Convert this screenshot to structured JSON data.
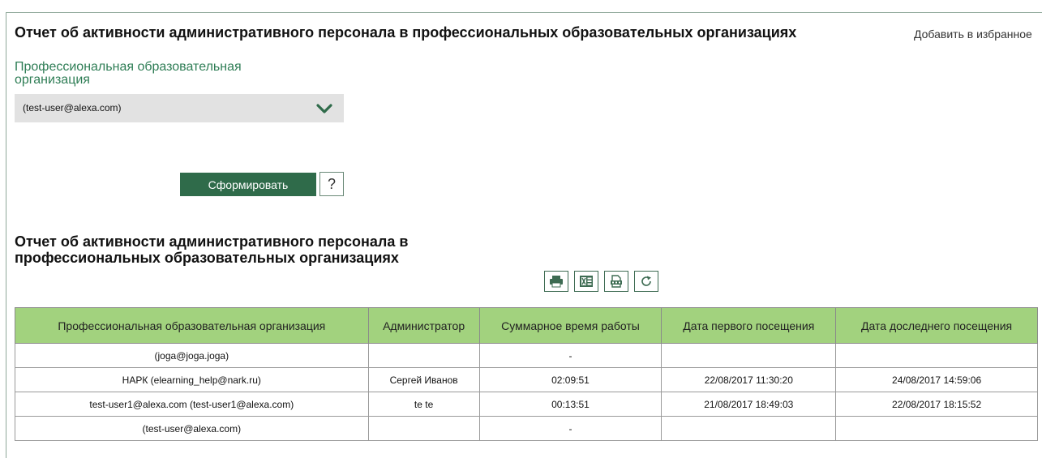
{
  "page": {
    "title": "Отчет об активности административного персонала в профессиональных образовательных организациях",
    "favorite_link": "Добавить в избранное"
  },
  "filter": {
    "label": "Профессиональная образовательная организация",
    "selected_value": "(test-user@alexa.com)",
    "icon": "chevron-down-icon"
  },
  "actions": {
    "submit_label": "Сформировать",
    "help_label": "?"
  },
  "report": {
    "title": "Отчет об активности административного персонала в профессиональных образовательных организациях",
    "toolbar": [
      "print-icon",
      "excel-icon",
      "pdf-icon",
      "refresh-icon"
    ],
    "columns": [
      "Профессиональная образовательная организация",
      "Администратор",
      "Суммарное время работы",
      "Дата первого посещения",
      "Дата доследнего посещения"
    ],
    "rows": [
      [
        "(joga@joga.joga)",
        "",
        "-",
        "",
        ""
      ],
      [
        "НАРК (elearning_help@nark.ru)",
        "Сергей Иванов",
        "02:09:51",
        "22/08/2017 11:30:20",
        "24/08/2017 14:59:06"
      ],
      [
        "test-user1@alexa.com (test-user1@alexa.com)",
        "te te",
        "00:13:51",
        "21/08/2017 18:49:03",
        "22/08/2017 18:15:52"
      ],
      [
        "(test-user@alexa.com)",
        "",
        "-",
        "",
        ""
      ]
    ]
  },
  "colors": {
    "accent": "#2f6b4a",
    "label_green": "#2e7d55",
    "header_green": "#a2d27e",
    "select_bg": "#e2e2e2"
  }
}
